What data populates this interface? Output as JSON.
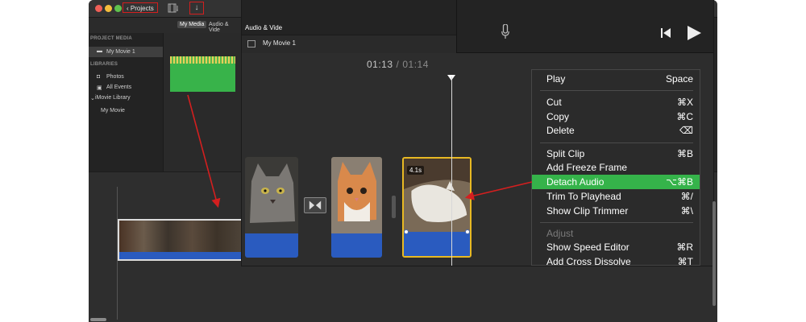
{
  "window": {
    "title": "My Movie 1"
  },
  "toolbar": {
    "projects_label": "Projects",
    "import_icon": "↓",
    "share_icon": "⇪"
  },
  "media_tabs": [
    "My Media",
    "Audio & Vide"
  ],
  "sidebar": {
    "project_media_header": "PROJECT MEDIA",
    "project_item": "My Movie 1",
    "libraries_header": "LIBRARIES",
    "photos": "Photos",
    "all_events": "All Events",
    "library": "iMovie Library",
    "library_movie": "My Movie"
  },
  "browser": {
    "title": "My Movie 1"
  },
  "viewer": {
    "current_time": "01:13",
    "separator": "/",
    "total_time": "01:14"
  },
  "clips": {
    "selected_duration": "4.1s"
  },
  "context_menu": {
    "items": [
      {
        "label": "Play",
        "shortcut": "Space"
      },
      {
        "label": "Cut",
        "shortcut": "⌘X"
      },
      {
        "label": "Copy",
        "shortcut": "⌘C"
      },
      {
        "label": "Delete",
        "shortcut": "⌫"
      },
      {
        "label": "Split Clip",
        "shortcut": "⌘B"
      },
      {
        "label": "Add Freeze Frame",
        "shortcut": ""
      },
      {
        "label": "Detach Audio",
        "shortcut": "⌥⌘B"
      },
      {
        "label": "Trim To Playhead",
        "shortcut": "⌘/"
      },
      {
        "label": "Show Clip Trimmer",
        "shortcut": "⌘\\"
      },
      {
        "label": "Adjust",
        "shortcut": ""
      },
      {
        "label": "Show Speed Editor",
        "shortcut": "⌘R"
      },
      {
        "label": "Add Cross Dissolve",
        "shortcut": "⌘T"
      }
    ],
    "highlighted_index": 6,
    "highlight_color": "#35b34a"
  },
  "colors": {
    "annotation_red": "#d31f1f",
    "audio_blue": "#2a5bbf",
    "selection_yellow": "#e8b923",
    "media_green": "#38b34a"
  }
}
